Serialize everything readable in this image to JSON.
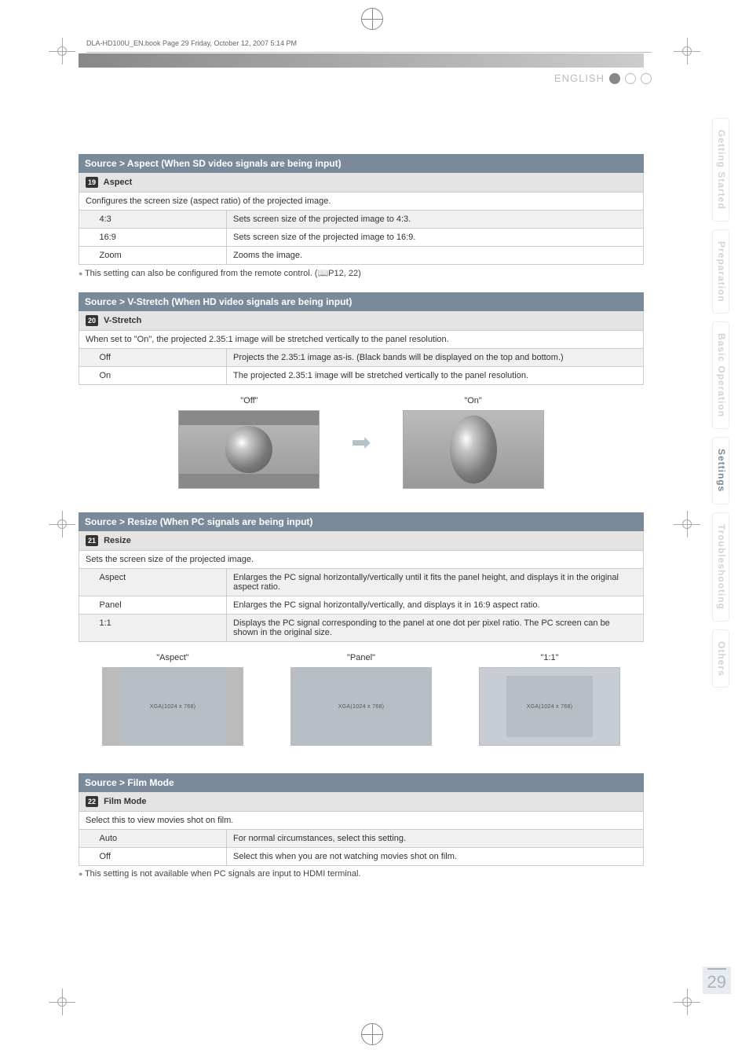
{
  "book_meta": "DLA-HD100U_EN.book  Page 29  Friday, October 12, 2007  5:14 PM",
  "lang": "ENGLISH",
  "page_number": "29",
  "side_tabs": {
    "t0": "Getting Started",
    "t1": "Preparation",
    "t2": "Basic Operation",
    "t3": "Settings",
    "t4": "Troubleshooting",
    "t5": "Others"
  },
  "sections": {
    "aspect": {
      "title": "Source > Aspect (When SD video signals are being input)",
      "num": "19",
      "subtitle": "Aspect",
      "desc": "Configures the screen size (aspect ratio) of the projected image.",
      "rows": [
        {
          "name": "4:3",
          "val": "Sets screen size of the projected image to 4:3."
        },
        {
          "name": "16:9",
          "val": "Sets screen size of the projected image to 16:9."
        },
        {
          "name": "Zoom",
          "val": "Zooms the image."
        }
      ],
      "note": "This setting can also be configured from the remote control. (📖P12, 22)"
    },
    "vstretch": {
      "title": "Source > V-Stretch (When HD video signals are being input)",
      "num": "20",
      "subtitle": "V-Stretch",
      "desc": "When set to \"On\", the projected 2.35:1 image will be stretched vertically to the panel resolution.",
      "rows": [
        {
          "name": "Off",
          "val": "Projects the 2.35:1 image as-is. (Black bands will be displayed on the top and bottom.)"
        },
        {
          "name": "On",
          "val": "The projected 2.35:1 image will be stretched vertically to the panel resolution."
        }
      ],
      "illus": {
        "off": "\"Off\"",
        "on": "\"On\""
      }
    },
    "resize": {
      "title": "Source > Resize (When PC signals are being input)",
      "num": "21",
      "subtitle": "Resize",
      "desc": "Sets the screen size of the projected image.",
      "rows": [
        {
          "name": "Aspect",
          "val": "Enlarges the PC signal horizontally/vertically until it fits the panel height, and displays it in the original aspect ratio."
        },
        {
          "name": "Panel",
          "val": "Enlarges the PC signal horizontally/vertically, and displays it in 16:9 aspect ratio."
        },
        {
          "name": "1:1",
          "val": "Displays the PC signal corresponding to the panel at one dot per pixel ratio. The PC screen can be shown in the original size."
        }
      ],
      "illus": {
        "aspect": "\"Aspect\"",
        "panel": "\"Panel\"",
        "one": "\"1:1\"",
        "res": "XGA(1024 x 768)"
      }
    },
    "film": {
      "title": "Source > Film Mode",
      "num": "22",
      "subtitle": "Film Mode",
      "desc": "Select this to view movies shot on film.",
      "rows": [
        {
          "name": "Auto",
          "val": "For normal circumstances, select this setting."
        },
        {
          "name": "Off",
          "val": "Select this when you are not watching movies shot on film."
        }
      ],
      "note": "This setting is not available when PC signals are input to HDMI terminal."
    }
  }
}
